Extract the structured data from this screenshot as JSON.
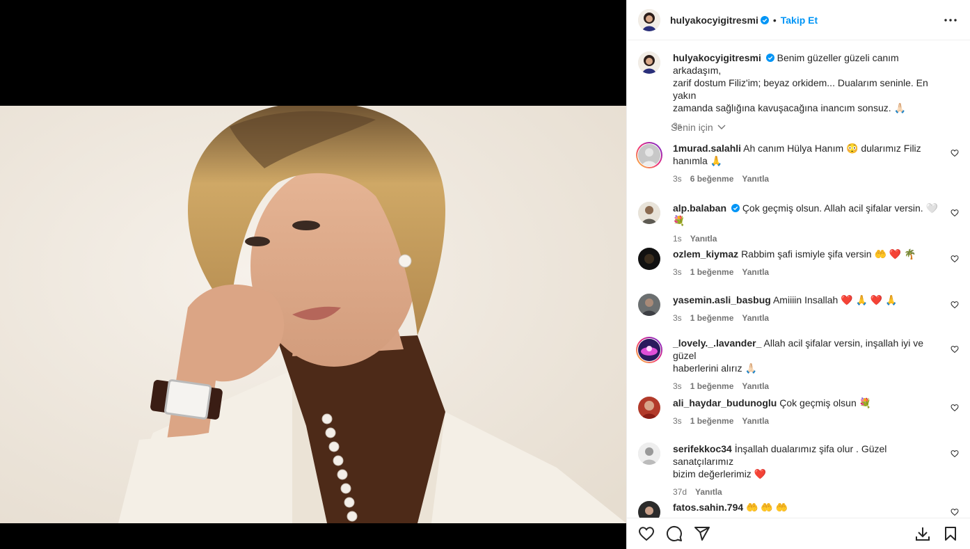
{
  "post": {
    "author": "hulyakocyigitresmi",
    "follow_label": "Takip Et",
    "caption": "Benim güzeller güzeli canım arkadaşım, zarif dostum Filiz'im; beyaz orkidem... Dualarım seninle. En yakın zamanda sağlığına kavuşacağına inancım sonsuz. 🙏🏻",
    "caption_line1": "Benim güzeller güzeli canım arkadaşım,",
    "caption_line2": "zarif dostum Filiz'im; beyaz orkidem... Dualarım seninle. En yakın",
    "caption_line3": "zamanda sağlığına kavuşacağına inancım sonsuz. 🙏🏻",
    "time": "3s"
  },
  "filter_label": "Senin için",
  "reply_label": "Yanıtla",
  "comments": [
    {
      "user": "1murad.salahli",
      "line1": "Ah canım Hülya Hanım 😳 dularımız Filiz",
      "line2": "hanımla 🙏",
      "time": "3s",
      "likes": "6 beğenme",
      "story_ring": true
    },
    {
      "user": "alp.balaban",
      "verified": true,
      "line1": "Çok geçmiş olsun. Allah acil şifalar versin. 🤍 💐",
      "line2": "",
      "time": "1s",
      "likes": ""
    },
    {
      "user": "ozlem_kiymaz",
      "line1": "Rabbim şafi ismiyle şifa versin 🤲 ❤️ 🌴",
      "line2": "",
      "time": "3s",
      "likes": "1 beğenme"
    },
    {
      "user": "yasemin.asli_basbug",
      "line1": "Amiiiin Insallah ❤️ 🙏 ❤️ 🙏",
      "line2": "",
      "time": "3s",
      "likes": "1 beğenme"
    },
    {
      "user": "_lovely._.lavander_",
      "line1": "Allah acil şifalar versin, inşallah iyi ve güzel",
      "line2": "haberlerini alırız 🙏🏻",
      "time": "3s",
      "likes": "1 beğenme",
      "story_ring": true
    },
    {
      "user": "ali_haydar_budunoglu",
      "line1": "Çok geçmiş olsun 💐",
      "line2": "",
      "time": "3s",
      "likes": "1 beğenme"
    },
    {
      "user": "serifekkoc34",
      "line1": "İnşallah dualarımız şifa olur . Güzel sanatçılarımız",
      "line2": "bizim değerlerimiz ❤️",
      "time": "37d",
      "likes": ""
    },
    {
      "user": "fatos.sahin.794",
      "line1": "🤲 🤲 🤲",
      "line2": "",
      "time": "",
      "likes": ""
    }
  ],
  "icons": [
    "like-icon",
    "comment-icon",
    "share-icon",
    "download-icon",
    "save-icon",
    "more-options-icon",
    "verified-badge-icon"
  ],
  "colors": {
    "link": "#0095f6",
    "text": "#262626",
    "muted": "#737373",
    "verified": "#0095f6"
  }
}
